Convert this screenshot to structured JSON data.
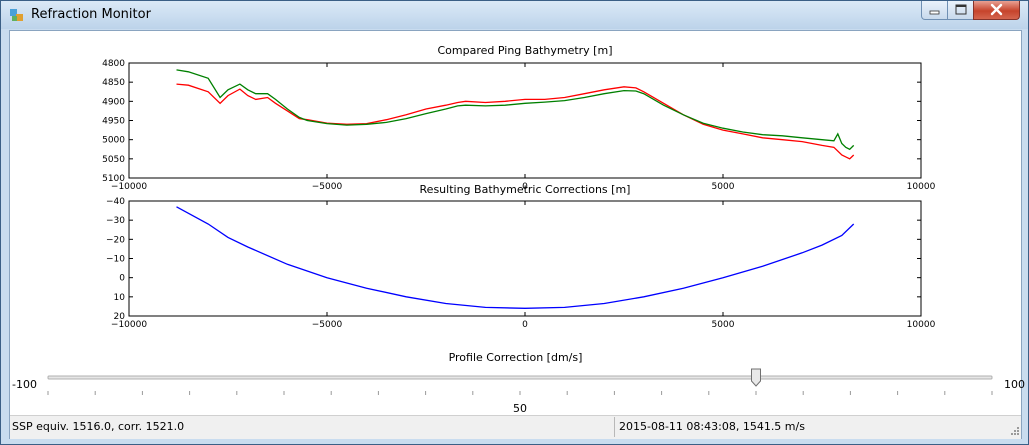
{
  "window": {
    "title": "Refraction Monitor"
  },
  "colors": {
    "line_red": "#ff0000",
    "line_green": "#008000",
    "line_blue": "#0000ff"
  },
  "chart_data": [
    {
      "type": "line",
      "title": "Compared Ping Bathymetry [m]",
      "xlim": [
        -10000,
        10000
      ],
      "ylim": [
        5100,
        4800
      ],
      "y_inverted": true,
      "x_ticks": [
        -10000,
        -5000,
        0,
        5000,
        10000
      ],
      "x_tick_labels": [
        "−10000",
        "−5000",
        "0",
        "5000",
        "10000"
      ],
      "y_ticks": [
        4800,
        4850,
        4900,
        4950,
        5000,
        5050,
        5100
      ],
      "y_tick_labels": [
        "4800",
        "4850",
        "4900",
        "4950",
        "5000",
        "5050",
        "5100"
      ],
      "series": [
        {
          "color": "red",
          "x": [
            -8800,
            -8500,
            -8000,
            -7700,
            -7500,
            -7200,
            -7000,
            -6800,
            -6500,
            -6300,
            -6000,
            -5700,
            -5500,
            -5000,
            -4500,
            -4000,
            -3500,
            -3000,
            -2500,
            -2000,
            -1700,
            -1500,
            -1000,
            -500,
            0,
            500,
            1000,
            1500,
            2000,
            2500,
            2800,
            3000,
            3500,
            4000,
            4500,
            5000,
            5500,
            6000,
            6500,
            7000,
            7500,
            7800,
            8000,
            8100,
            8200,
            8300
          ],
          "y": [
            4855,
            4858,
            4875,
            4905,
            4885,
            4868,
            4885,
            4895,
            4890,
            4905,
            4925,
            4945,
            4948,
            4957,
            4960,
            4958,
            4948,
            4935,
            4920,
            4910,
            4903,
            4900,
            4903,
            4900,
            4895,
            4895,
            4890,
            4880,
            4870,
            4862,
            4865,
            4875,
            4905,
            4935,
            4960,
            4975,
            4985,
            4995,
            5000,
            5005,
            5015,
            5020,
            5040,
            5045,
            5050,
            5040
          ]
        },
        {
          "color": "green",
          "x": [
            -8800,
            -8500,
            -8000,
            -7700,
            -7500,
            -7200,
            -7000,
            -6800,
            -6500,
            -6300,
            -6000,
            -5700,
            -5500,
            -5000,
            -4500,
            -4000,
            -3500,
            -3000,
            -2500,
            -2000,
            -1700,
            -1500,
            -1000,
            -500,
            0,
            500,
            1000,
            1500,
            2000,
            2500,
            2800,
            3000,
            3500,
            4000,
            4500,
            5000,
            5500,
            6000,
            6500,
            7000,
            7500,
            7800,
            7900,
            8000,
            8100,
            8200,
            8300
          ],
          "y": [
            4818,
            4823,
            4840,
            4890,
            4870,
            4855,
            4870,
            4880,
            4880,
            4895,
            4920,
            4942,
            4950,
            4958,
            4962,
            4960,
            4955,
            4945,
            4932,
            4920,
            4912,
            4910,
            4912,
            4910,
            4905,
            4902,
            4898,
            4890,
            4880,
            4872,
            4873,
            4880,
            4910,
            4935,
            4957,
            4970,
            4980,
            4987,
            4990,
            4995,
            5000,
            5003,
            4985,
            5010,
            5020,
            5025,
            5015
          ]
        }
      ]
    },
    {
      "type": "line",
      "title": "Resulting Bathymetric Corrections [m]",
      "xlim": [
        -10000,
        10000
      ],
      "ylim": [
        20,
        -40
      ],
      "y_inverted": true,
      "x_ticks": [
        -10000,
        -5000,
        0,
        5000,
        10000
      ],
      "x_tick_labels": [
        "−10000",
        "−5000",
        "0",
        "5000",
        "10000"
      ],
      "y_ticks": [
        -40,
        -30,
        -20,
        -10,
        0,
        10,
        20
      ],
      "y_tick_labels": [
        "−40",
        "−30",
        "−20",
        "−10",
        "0",
        "10",
        "20"
      ],
      "series": [
        {
          "color": "blue",
          "x": [
            -8800,
            -8000,
            -7500,
            -7000,
            -6000,
            -5000,
            -4000,
            -3000,
            -2000,
            -1000,
            0,
            1000,
            2000,
            3000,
            4000,
            5000,
            6000,
            7000,
            7500,
            8000,
            8300
          ],
          "y": [
            -37,
            -28,
            -21,
            -16,
            -7,
            0,
            5.5,
            10,
            13.5,
            15.5,
            16,
            15.5,
            13.5,
            10,
            5.5,
            0,
            -6,
            -13,
            -17,
            -22,
            -28
          ]
        }
      ]
    }
  ],
  "slider": {
    "title": "Profile Correction [dm/s]",
    "min_label": "-100",
    "max_label": "100",
    "value_label": "50",
    "min": -100,
    "max": 100,
    "value": 50
  },
  "status": {
    "left_text": "SSP equiv. 1516.0, corr. 1521.0",
    "right_text": "2015-08-11 08:43:08, 1541.5 m/s"
  }
}
